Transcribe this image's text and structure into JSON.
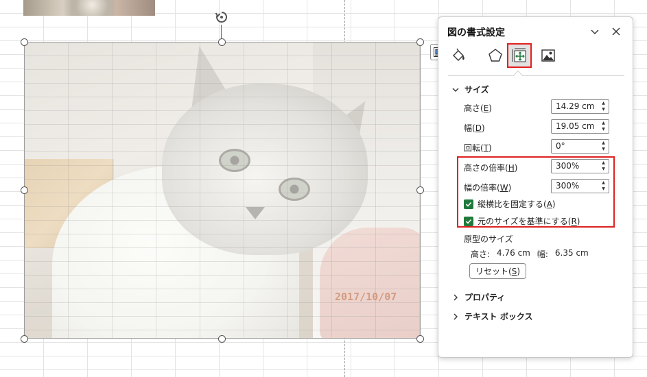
{
  "pane": {
    "title": "図の書式設定",
    "tabs": [
      "塗りつぶしと線",
      "効果",
      "サイズとプロパティ",
      "図"
    ],
    "size_section": {
      "title": "サイズ",
      "height": {
        "label": "高さ",
        "key": "E",
        "value": "14.29 cm"
      },
      "width": {
        "label": "幅",
        "key": "D",
        "value": "19.05 cm"
      },
      "rotation": {
        "label": "回転",
        "key": "T",
        "value": "0°"
      },
      "scale_height": {
        "label": "高さの倍率",
        "key": "H",
        "value": "300%"
      },
      "scale_width": {
        "label": "幅の倍率",
        "key": "W",
        "value": "300%"
      },
      "lock_aspect": {
        "label": "縦横比を固定する",
        "key": "A",
        "checked": true
      },
      "relative_original": {
        "label": "元のサイズを基準にする",
        "key": "R",
        "checked": true
      },
      "original_title": "原型のサイズ",
      "original_height_label": "高さ:",
      "original_height": "4.76 cm",
      "original_width_label": "幅:",
      "original_width": "6.35 cm",
      "reset": {
        "label": "リセット",
        "key": "S"
      }
    },
    "properties_section": {
      "title": "プロパティ"
    },
    "textbox_section": {
      "title": "テキスト ボックス"
    }
  },
  "picture": {
    "date_stamp": "2017/10/07"
  },
  "colors": {
    "accent": "#1f7a3c",
    "highlight": "#e02020"
  }
}
